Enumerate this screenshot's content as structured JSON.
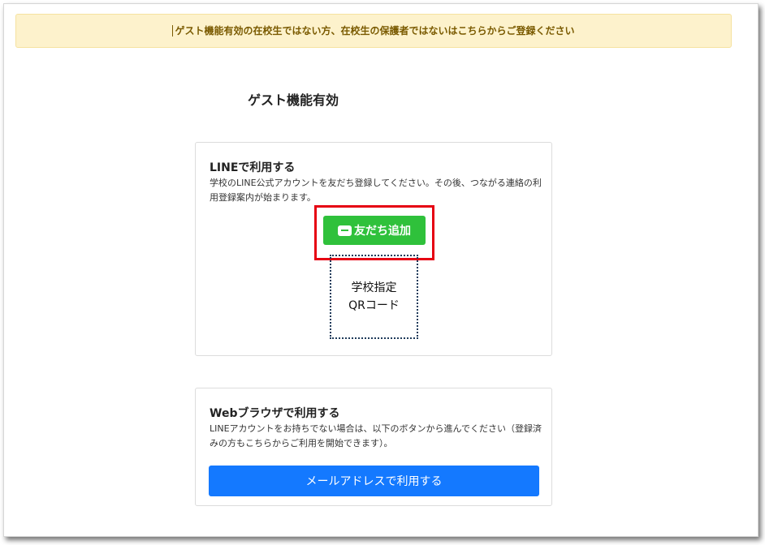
{
  "notice": {
    "text": "ゲスト機能有効の在校生ではない方、在校生の保護者ではないはこちらからご登録ください"
  },
  "page": {
    "title": "ゲスト機能有効"
  },
  "line_card": {
    "title": "LINEで利用する",
    "description": "学校のLINE公式アカウントを友だち登録してください。その後、つながる連絡の利用登録案内が始まります。",
    "add_friend_button": "友だち追加",
    "add_friend_button_color": "#2fc13b",
    "highlight_color": "#e60012",
    "qr_line1": "学校指定",
    "qr_line2": "QRコード"
  },
  "web_card": {
    "title": "Webブラウザで利用する",
    "description": "LINEアカウントをお持ちでない場合は、以下のボタンから進んでください（登録済みの方もこちらからご利用を開始できます）。",
    "email_button": "メールアドレスで利用する",
    "email_button_color": "#1479ff"
  },
  "notice_color": "#fdf2cc"
}
